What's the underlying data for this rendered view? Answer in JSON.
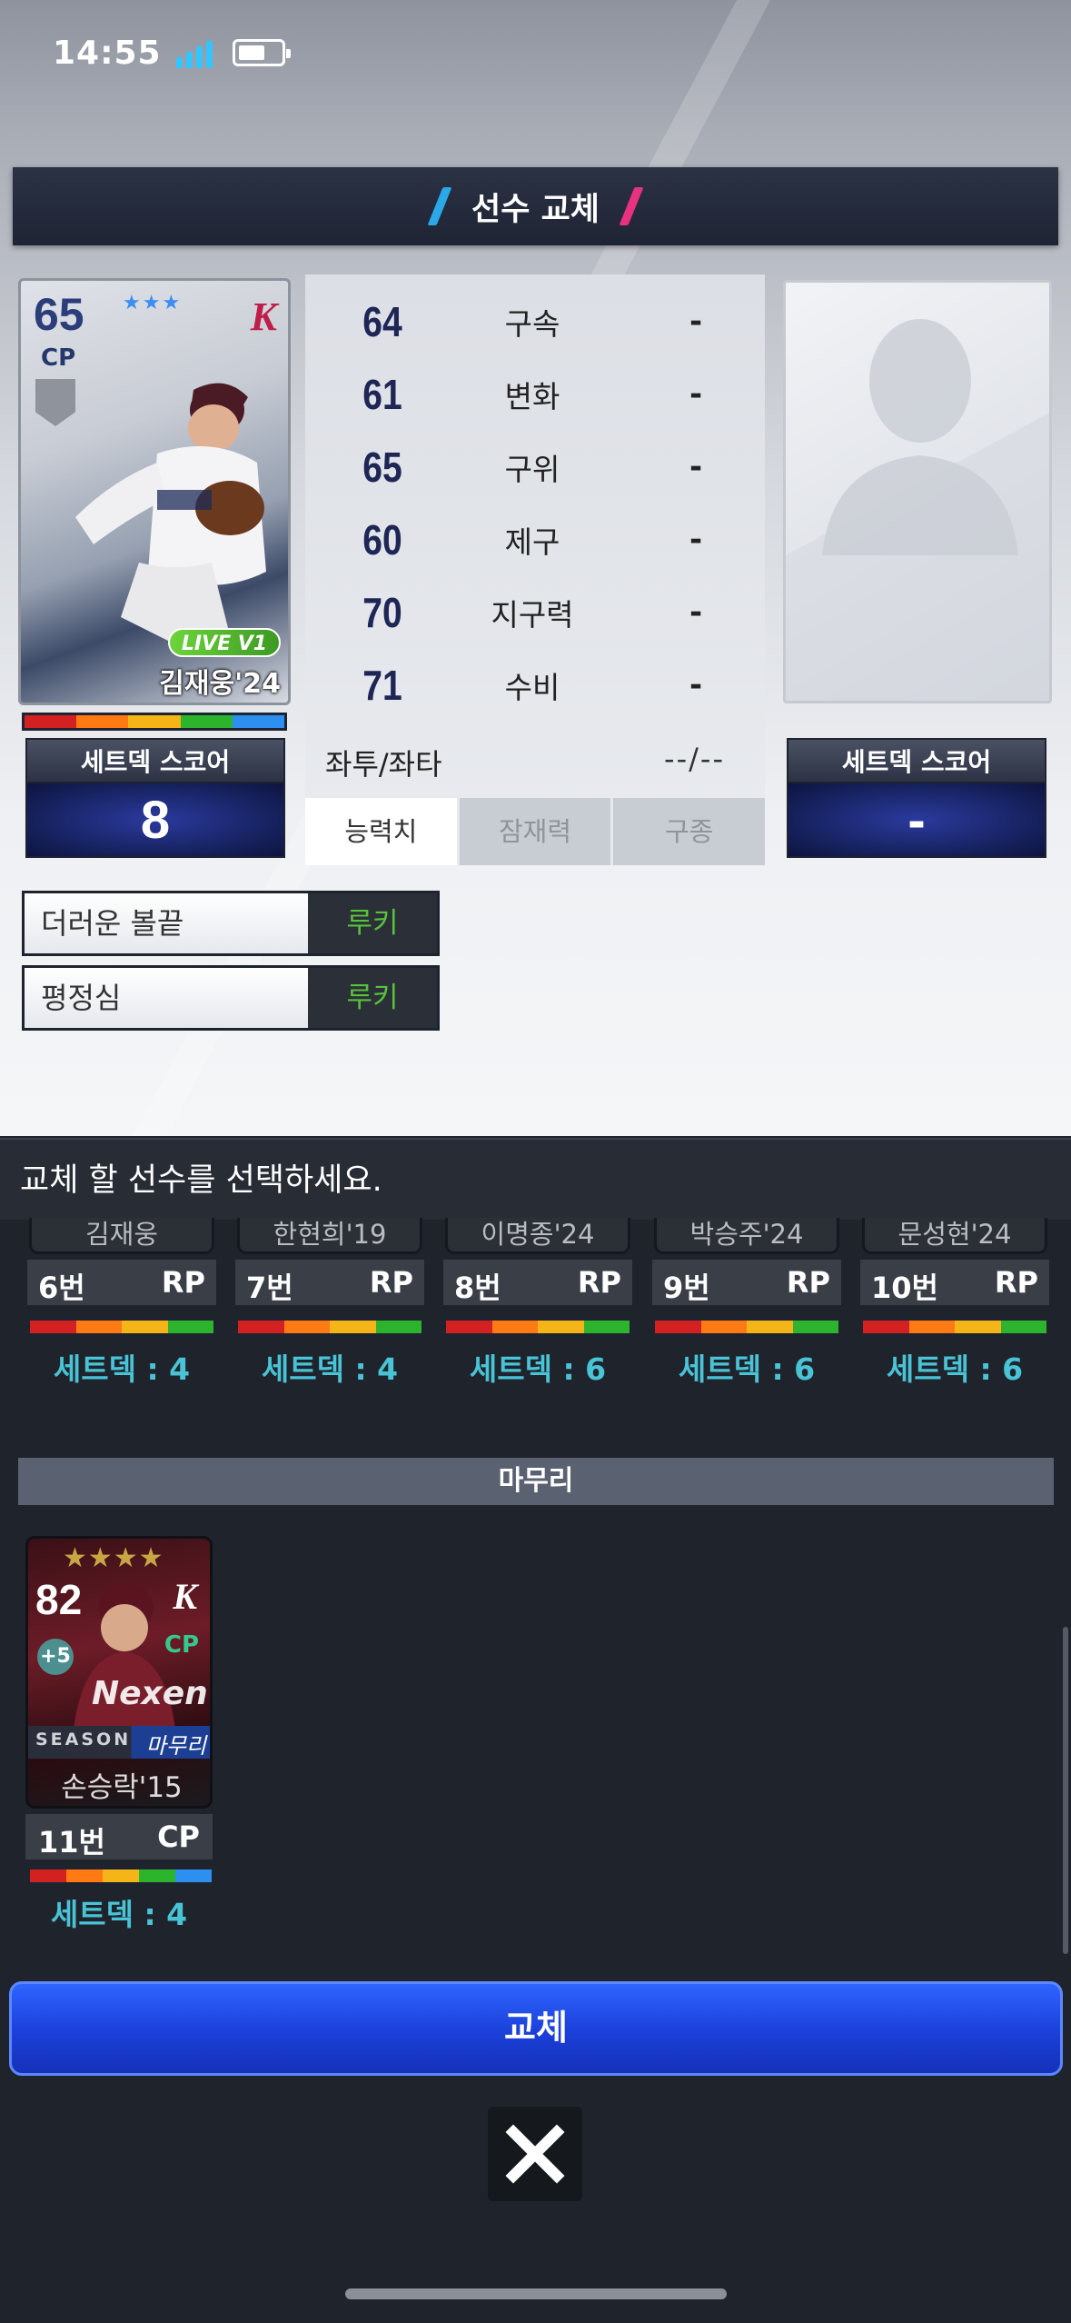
{
  "status_bar": {
    "time": "14:55"
  },
  "header": {
    "title": "선수 교체"
  },
  "current_player": {
    "overall": "65",
    "position": "CP",
    "stars": "★★★",
    "team_logo": "K",
    "badge": "LIVE V1",
    "name": "김재웅'24",
    "set_deck_label": "세트덱 스코어",
    "set_deck_score": "8"
  },
  "stats": {
    "rows": [
      {
        "value": "64",
        "name": "구속",
        "compare": "-"
      },
      {
        "value": "61",
        "name": "변화",
        "compare": "-"
      },
      {
        "value": "65",
        "name": "구위",
        "compare": "-"
      },
      {
        "value": "60",
        "name": "제구",
        "compare": "-"
      },
      {
        "value": "70",
        "name": "지구력",
        "compare": "-"
      },
      {
        "value": "71",
        "name": "수비",
        "compare": "-"
      }
    ],
    "hand_label": "좌투/좌타",
    "hand_value": "--/--",
    "tabs": [
      "능력치",
      "잠재력",
      "구종"
    ]
  },
  "replacement": {
    "set_deck_label": "세트덱 스코어",
    "set_deck_score": "-"
  },
  "abilities": [
    {
      "name": "더러운 볼끝",
      "grade": "루키"
    },
    {
      "name": "평정심",
      "grade": "루키"
    }
  ],
  "prompt": "교체 할 선수를 선택하세요.",
  "roster": [
    {
      "name": "김재웅",
      "number": "6번",
      "pos": "RP",
      "set_deck": "세트덱 : 4"
    },
    {
      "name": "한현희'19",
      "number": "7번",
      "pos": "RP",
      "set_deck": "세트덱 : 4"
    },
    {
      "name": "이명종'24",
      "number": "8번",
      "pos": "RP",
      "set_deck": "세트덱 : 6"
    },
    {
      "name": "박승주'24",
      "number": "9번",
      "pos": "RP",
      "set_deck": "세트덱 : 6"
    },
    {
      "name": "문성현'24",
      "number": "10번",
      "pos": "RP",
      "set_deck": "세트덱 : 6"
    }
  ],
  "closer_section": {
    "title": "마무리",
    "card": {
      "overall": "82",
      "stars": "★★★★",
      "plus": "+5",
      "team_logo": "K",
      "position": "CP",
      "sponsor": "Nexen",
      "season": "SEASON",
      "role": "마무리",
      "name": "손승락'15",
      "number": "11번",
      "pos": "CP",
      "set_deck": "세트덱 : 4"
    }
  },
  "actions": {
    "replace": "교체"
  },
  "colors": {
    "accent_blue": "#2e64ff",
    "slash_blue": "#2aa8e8",
    "slash_pink": "#e8327f",
    "grade_green": "#57c23a",
    "set_deck_cyan": "#49c3d6"
  },
  "rating_bar_colors": [
    "#d32121",
    "#ff7a12",
    "#f5b418",
    "#2cb52c",
    "#2d8ff0"
  ]
}
